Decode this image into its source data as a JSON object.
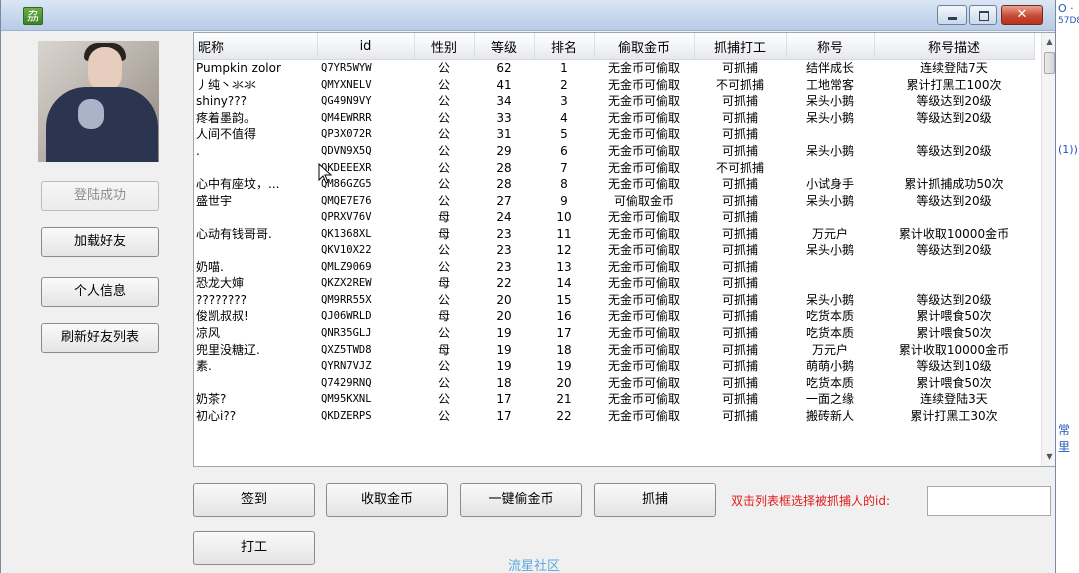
{
  "sidebar": {
    "login_label": "登陆成功",
    "load_friends_label": "加载好友",
    "profile_label": "个人信息",
    "refresh_label": "刷新好友列表"
  },
  "table": {
    "columns": [
      "昵称",
      "id",
      "性别",
      "等级",
      "排名",
      "偷取金币",
      "抓捕打工",
      "称号",
      "称号描述"
    ],
    "rows": [
      [
        "Pumpkin zolor",
        "Q7YR5WYW",
        "公",
        "62",
        "1",
        "无金币可偷取",
        "可抓捕",
        "结伴成长",
        "连续登陆7天"
      ],
      [
        "丿纯丶氺氺",
        "QMYXNELV",
        "公",
        "41",
        "2",
        "无金币可偷取",
        "不可抓捕",
        "工地常客",
        "累计打黑工100次"
      ],
      [
        "shiny???",
        "QG49N9VY",
        "公",
        "34",
        "3",
        "无金币可偷取",
        "可抓捕",
        "呆头小鹅",
        "等级达到20级"
      ],
      [
        "疼着墨韵。",
        "QM4EWRRR",
        "公",
        "33",
        "4",
        "无金币可偷取",
        "可抓捕",
        "呆头小鹅",
        "等级达到20级"
      ],
      [
        "人间不值得",
        "QP3X072R",
        "公",
        "31",
        "5",
        "无金币可偷取",
        "可抓捕",
        "",
        ""
      ],
      [
        ".",
        "QDVN9X5Q",
        "公",
        "29",
        "6",
        "无金币可偷取",
        "可抓捕",
        "呆头小鹅",
        "等级达到20级"
      ],
      [
        "",
        "QKDEEEXR",
        "公",
        "28",
        "7",
        "无金币可偷取",
        "不可抓捕",
        "",
        ""
      ],
      [
        "心中有座坟，...",
        "QM86GZG5",
        "公",
        "28",
        "8",
        "无金币可偷取",
        "可抓捕",
        "小试身手",
        "累计抓捕成功50次"
      ],
      [
        "盛世宇",
        "QMQE7E76",
        "公",
        "27",
        "9",
        "可偷取金币",
        "可抓捕",
        "呆头小鹅",
        "等级达到20级"
      ],
      [
        "",
        "QPRXV76V",
        "母",
        "24",
        "10",
        "无金币可偷取",
        "可抓捕",
        "",
        ""
      ],
      [
        "心动有钱哥哥.",
        "QK1368XL",
        "母",
        "23",
        "11",
        "无金币可偷取",
        "可抓捕",
        "万元户",
        "累计收取10000金币"
      ],
      [
        "",
        "QKV10X22",
        "公",
        "23",
        "12",
        "无金币可偷取",
        "可抓捕",
        "呆头小鹅",
        "等级达到20级"
      ],
      [
        "奶喵.",
        "QMLZ9069",
        "公",
        "23",
        "13",
        "无金币可偷取",
        "可抓捕",
        "",
        ""
      ],
      [
        "恐龙大婶",
        "QKZX2REW",
        "母",
        "22",
        "14",
        "无金币可偷取",
        "可抓捕",
        "",
        ""
      ],
      [
        "????????",
        "QM9RR55X",
        "公",
        "20",
        "15",
        "无金币可偷取",
        "可抓捕",
        "呆头小鹅",
        "等级达到20级"
      ],
      [
        "俊凯叔叔!",
        "QJ06WRLD",
        "母",
        "20",
        "16",
        "无金币可偷取",
        "可抓捕",
        "吃货本质",
        "累计喂食50次"
      ],
      [
        "凉风",
        "QNR35GLJ",
        "公",
        "19",
        "17",
        "无金币可偷取",
        "可抓捕",
        "吃货本质",
        "累计喂食50次"
      ],
      [
        "兜里没糖辽.",
        "QXZ5TWD8",
        "母",
        "19",
        "18",
        "无金币可偷取",
        "可抓捕",
        "万元户",
        "累计收取10000金币"
      ],
      [
        "素.",
        "QYRN7VJZ",
        "公",
        "19",
        "19",
        "无金币可偷取",
        "可抓捕",
        "萌萌小鹅",
        "等级达到10级"
      ],
      [
        "",
        "Q7429RNQ",
        "公",
        "18",
        "20",
        "无金币可偷取",
        "可抓捕",
        "吃货本质",
        "累计喂食50次"
      ],
      [
        "奶茶?",
        "QM95KXNL",
        "公",
        "17",
        "21",
        "无金币可偷取",
        "可抓捕",
        "一面之缘",
        "连续登陆3天"
      ],
      [
        "初心i??",
        "QKDZERPS",
        "公",
        "17",
        "22",
        "无金币可偷取",
        "可抓捕",
        "搬砖新人",
        "累计打黑工30次"
      ]
    ]
  },
  "actions": {
    "sign_in": "签到",
    "collect_coins": "收取金币",
    "steal_all": "一键偷金币",
    "capture": "抓捕",
    "work": "打工",
    "hint": "双击列表框选择被抓捕人的id:",
    "id_value": ""
  },
  "watermark": "流星社区",
  "background_fragments": {
    "a": "O ·",
    "b": "57D8",
    "c": "(1))",
    "d": "常里"
  },
  "icons": {
    "app": "app-icon",
    "minimize": "minimize-icon",
    "maximize": "maximize-icon",
    "close": "close-icon",
    "cursor": "mouse-cursor-icon"
  }
}
